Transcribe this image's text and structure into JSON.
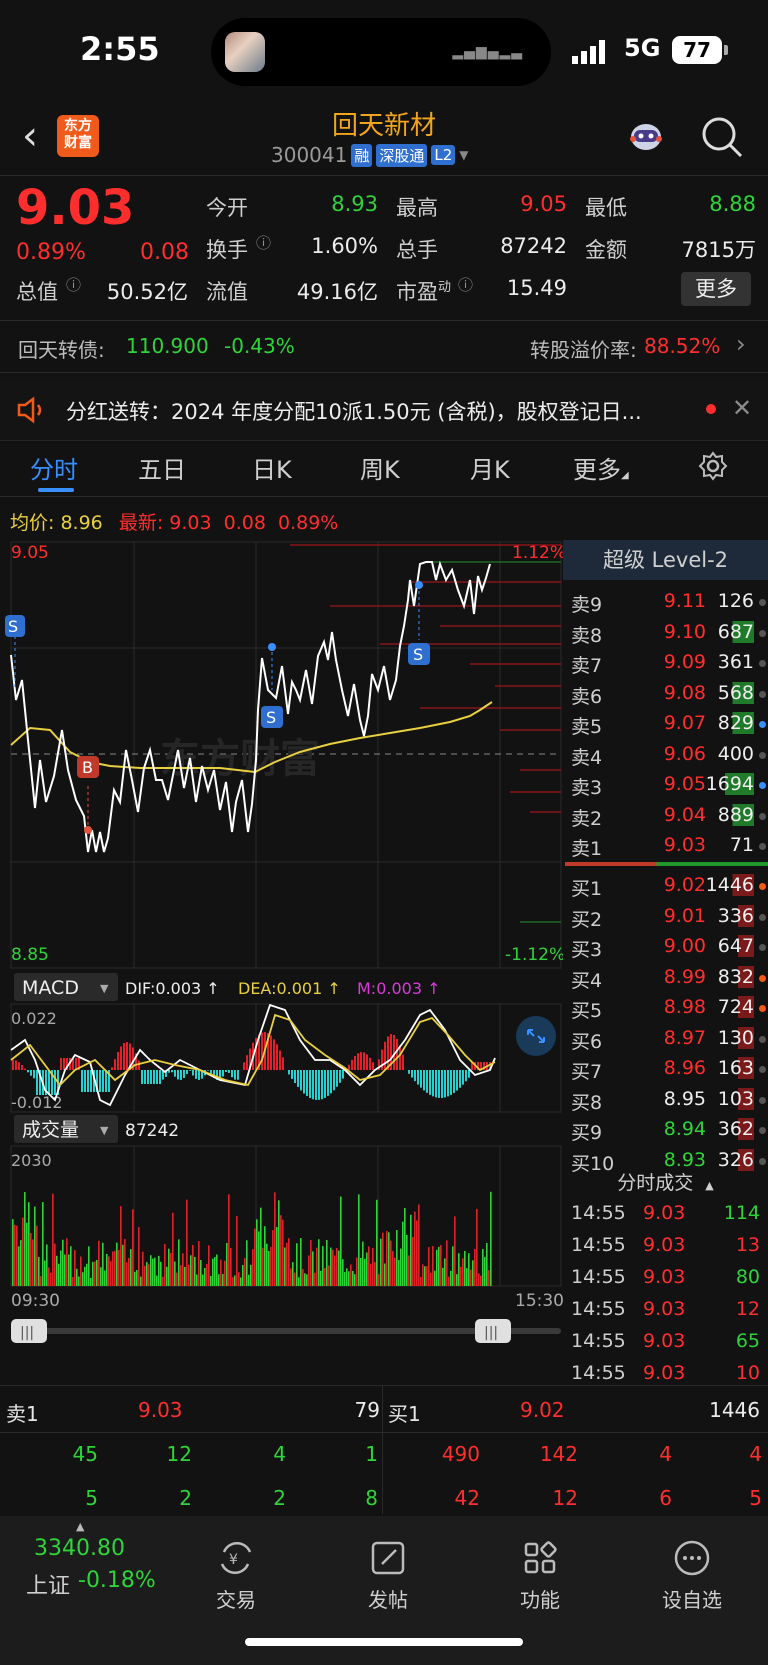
{
  "status": {
    "time": "2:55",
    "network": "5G",
    "battery": "77"
  },
  "header": {
    "back": "‹",
    "logo_line1": "东方",
    "logo_line2": "财富",
    "name": "回天新材",
    "code": "300041",
    "tags": [
      "融",
      "深股通",
      "L2"
    ]
  },
  "quote": {
    "price": "9.03",
    "pct": "0.89%",
    "change": "0.08",
    "labels": {
      "open": "今开",
      "high": "最高",
      "low": "最低",
      "turnover": "换手",
      "volume": "总手",
      "amount": "金额",
      "mktcap": "总值",
      "float": "流值",
      "pe": "市盈",
      "pe_sup": "动"
    },
    "values": {
      "open": "8.93",
      "high": "9.05",
      "low": "8.88",
      "turnover": "1.60%",
      "volume": "87242",
      "amount": "7815万",
      "mktcap": "50.52亿",
      "float": "49.16亿",
      "pe": "15.49"
    },
    "more": "更多"
  },
  "bond": {
    "name": "回天转债:",
    "price": "110.900",
    "pct": "-0.43%",
    "premium_label": "转股溢价率:",
    "premium": "88.52%"
  },
  "notice": {
    "text": "分红送转：2024 年度分配10派1.50元 (含税)，股权登记日..."
  },
  "tabs": [
    "分时",
    "五日",
    "日K",
    "周K",
    "月K",
    "更多"
  ],
  "avg": {
    "avg_label": "均价:",
    "avg": "8.96",
    "last_label": "最新:",
    "last": "9.03",
    "chg": "0.08",
    "pct": "0.89%"
  },
  "chart": {
    "y_high": "9.05",
    "y_low": "8.85",
    "mid": "8.95",
    "pct_high": "1.12%",
    "pct_low": "-1.12%",
    "watermark": "东方财富",
    "macd": {
      "name": "MACD",
      "dif": "DIF:0.003 ↑",
      "dea": "DEA:0.001 ↑",
      "m": "M:0.003 ↑",
      "top": "0.022",
      "bottom": "-0.012"
    },
    "vol": {
      "name": "成交量",
      "total": "87242",
      "top": "2030"
    },
    "time_start": "09:30",
    "time_end": "15:30",
    "markers": {
      "b": "B",
      "s": "S"
    }
  },
  "orderbook": {
    "title": "超级 Level-2",
    "asks": [
      {
        "label": "卖9",
        "price": "9.11",
        "vol": "126"
      },
      {
        "label": "卖8",
        "price": "9.10",
        "vol": "687"
      },
      {
        "label": "卖7",
        "price": "9.09",
        "vol": "361"
      },
      {
        "label": "卖6",
        "price": "9.08",
        "vol": "568"
      },
      {
        "label": "卖5",
        "price": "9.07",
        "vol": "829"
      },
      {
        "label": "卖4",
        "price": "9.06",
        "vol": "400"
      },
      {
        "label": "卖3",
        "price": "9.05",
        "vol": "1694"
      },
      {
        "label": "卖2",
        "price": "9.04",
        "vol": "889"
      },
      {
        "label": "卖1",
        "price": "9.03",
        "vol": "71"
      }
    ],
    "bids": [
      {
        "label": "买1",
        "price": "9.02",
        "vol": "1446"
      },
      {
        "label": "买2",
        "price": "9.01",
        "vol": "336"
      },
      {
        "label": "买3",
        "price": "9.00",
        "vol": "647"
      },
      {
        "label": "买4",
        "price": "8.99",
        "vol": "832"
      },
      {
        "label": "买5",
        "price": "8.98",
        "vol": "724"
      },
      {
        "label": "买6",
        "price": "8.97",
        "vol": "130"
      },
      {
        "label": "买7",
        "price": "8.96",
        "vol": "163"
      },
      {
        "label": "买8",
        "price": "8.95",
        "vol": "103"
      },
      {
        "label": "买9",
        "price": "8.94",
        "vol": "362"
      },
      {
        "label": "买10",
        "price": "8.93",
        "vol": "326"
      }
    ]
  },
  "ticks": {
    "title": "分时成交",
    "rows": [
      {
        "time": "14:55",
        "price": "9.03",
        "vol": "114"
      },
      {
        "time": "14:55",
        "price": "9.03",
        "vol": "13"
      },
      {
        "time": "14:55",
        "price": "9.03",
        "vol": "80"
      },
      {
        "time": "14:55",
        "price": "9.03",
        "vol": "12"
      },
      {
        "time": "14:55",
        "price": "9.03",
        "vol": "65"
      },
      {
        "time": "14:55",
        "price": "9.03",
        "vol": "10"
      }
    ]
  },
  "depth": {
    "ask_label": "卖1",
    "ask_price": "9.03",
    "ask_vol": "79",
    "bid_label": "买1",
    "bid_price": "9.02",
    "bid_vol": "1446",
    "ask_row1": [
      "45",
      "12",
      "4",
      "1"
    ],
    "ask_row2": [
      "5",
      "2",
      "2",
      "8"
    ],
    "bid_row1": [
      "490",
      "142",
      "4",
      "4"
    ],
    "bid_row2": [
      "42",
      "12",
      "6",
      "5"
    ]
  },
  "nav": {
    "index_value": "3340.80",
    "index_name": "上证",
    "index_pct": "-0.18%",
    "items": [
      "交易",
      "发帖",
      "功能",
      "设自选"
    ]
  }
}
